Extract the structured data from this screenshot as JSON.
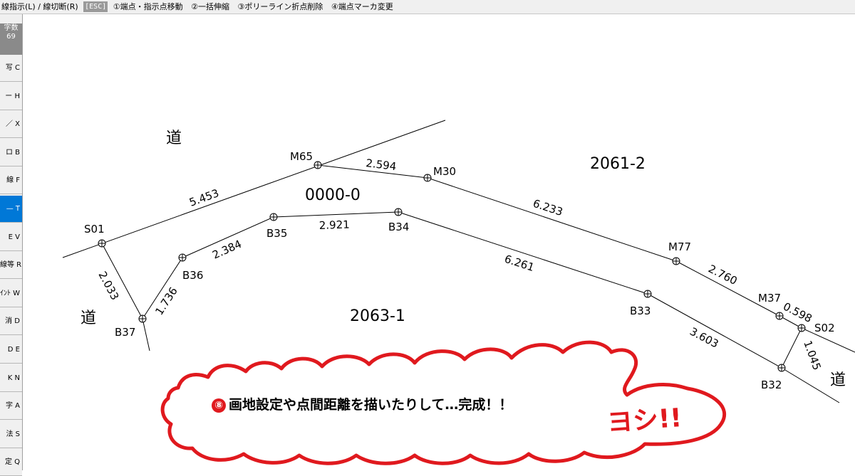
{
  "toolbar": {
    "mode": "線指示(L) / 線切断(R)",
    "esc": "[ESC]",
    "items": [
      "①端点・指示点移動",
      "②一括伸縮",
      "③ポリーライン折点削除",
      "④端点マーカ変更"
    ]
  },
  "sidebar": {
    "top_line1": "字数",
    "top_line2": "69",
    "buttons": [
      {
        "label": "写 C",
        "active": false
      },
      {
        "label": "ー H",
        "active": false
      },
      {
        "label": "／ X",
        "active": false
      },
      {
        "label": "ロ B",
        "active": false
      },
      {
        "label": "線 F",
        "active": false
      },
      {
        "label": "— T",
        "active": true
      },
      {
        "label": "E V",
        "active": false
      },
      {
        "label": "線等 R",
        "active": false
      },
      {
        "label": "ｲﾝﾄ W",
        "active": false
      },
      {
        "label": "消 D",
        "active": false
      },
      {
        "label": "D E",
        "active": false
      },
      {
        "label": "K N",
        "active": false
      },
      {
        "label": "字 A",
        "active": false
      },
      {
        "label": "法 S",
        "active": false
      },
      {
        "label": "定 Q",
        "active": false
      }
    ]
  },
  "drawing": {
    "points": {
      "S01": "S01",
      "M65": "M65",
      "M30": "M30",
      "M77": "M77",
      "M37": "M37",
      "S02": "S02",
      "B37": "B37",
      "B36": "B36",
      "B35": "B35",
      "B34": "B34",
      "B33": "B33",
      "B32": "B32"
    },
    "distances": {
      "S01_M65": "5.453",
      "M65_M30": "2.594",
      "M30_M77": "6.233",
      "M77_M37": "2.760",
      "M37_S02": "0.598",
      "S01_B37": "2.033",
      "B37_B36": "1.736",
      "B36_B35": "2.384",
      "B35_B34": "2.921",
      "B34_B33": "6.261",
      "B33_B32": "3.603",
      "B32_S02": "1.045"
    },
    "parcels": {
      "center": "0000-0",
      "upper_right": "2061-2",
      "lower": "2063-1"
    },
    "roads": {
      "upper_left": "道",
      "left": "道",
      "right": "道"
    }
  },
  "annotation": {
    "number": "⑧",
    "text": "画地設定や点間距離を描いたりして…完成！！",
    "exclaim": "ヨシ!!",
    "color": "#e0191e"
  }
}
